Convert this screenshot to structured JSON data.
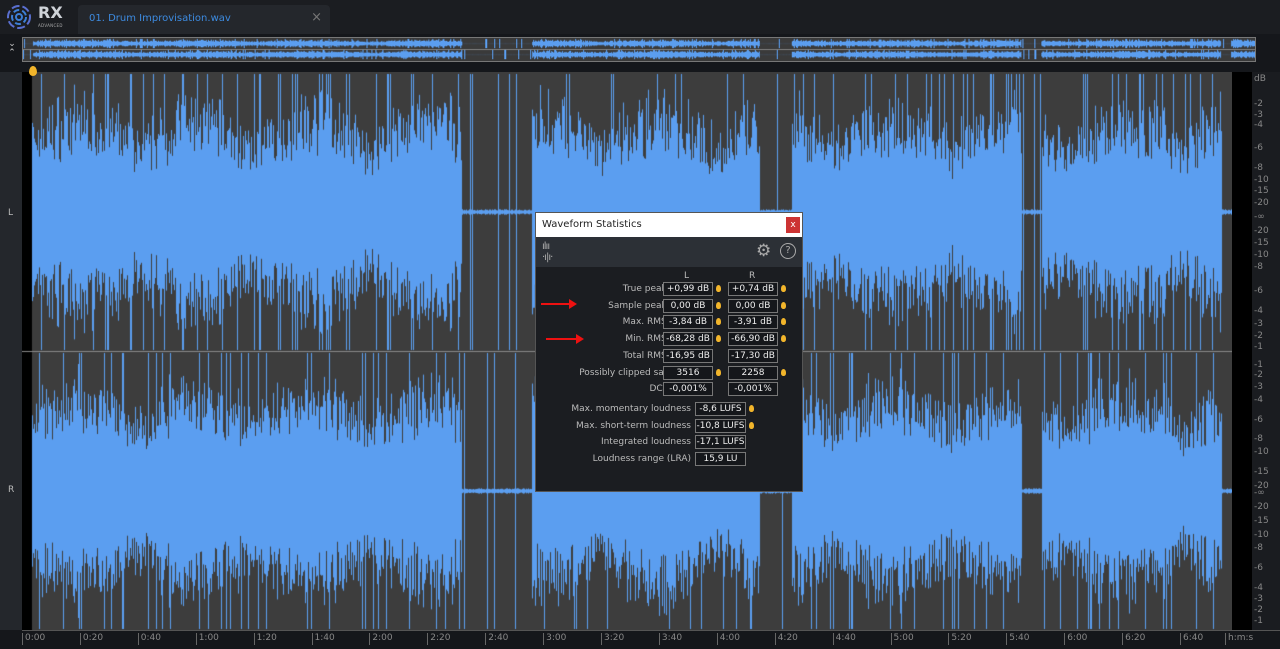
{
  "app": {
    "logo_text": "RX",
    "logo_sub": "ADVANCED"
  },
  "tab": {
    "title": "01. Drum Improvisation.wav",
    "close": "×"
  },
  "channels": {
    "left": "L",
    "right": "R"
  },
  "scale": {
    "unit": "dB",
    "ticks_top": [
      "-2",
      "-3",
      "-4",
      "-6",
      "-8",
      "-10",
      "-15",
      "-20",
      "-∞",
      "-20",
      "-15",
      "-10",
      "-8",
      "-6",
      "-4",
      "-3",
      "-2",
      "-1"
    ],
    "ticks_bottom": [
      "-1",
      "-2",
      "-3",
      "-4",
      "-6",
      "-8",
      "-10",
      "-15",
      "-20",
      "-∞",
      "-20",
      "-15",
      "-10",
      "-8",
      "-6",
      "-4",
      "-3",
      "-2",
      "-1"
    ]
  },
  "timeline": {
    "labels": [
      "0:00",
      "0:20",
      "0:40",
      "1:00",
      "1:20",
      "1:40",
      "2:00",
      "2:20",
      "2:40",
      "3:00",
      "3:20",
      "3:40",
      "4:00",
      "4:20",
      "4:40",
      "5:00",
      "5:20",
      "5:40",
      "6:00",
      "6:20",
      "6:40"
    ],
    "unit": "h:m:s"
  },
  "dialog": {
    "title": "Waveform Statistics",
    "close": "x",
    "col_l": "L",
    "col_r": "R",
    "rows": [
      {
        "label": "True peak level",
        "l": "+0,99 dB",
        "r": "+0,74 dB",
        "bulb_l": true,
        "bulb_r": true
      },
      {
        "label": "Sample peak level",
        "l": "0,00 dB",
        "r": "0,00 dB",
        "bulb_l": true,
        "bulb_r": true
      },
      {
        "label": "Max. RMS level",
        "l": "-3,84 dB",
        "r": "-3,91 dB",
        "bulb_l": true,
        "bulb_r": true
      },
      {
        "label": "Min. RMS level",
        "l": "-68,28 dB",
        "r": "-66,90 dB",
        "bulb_l": true,
        "bulb_r": true
      },
      {
        "label": "Total RMS level",
        "l": "-16,95 dB",
        "r": "-17,30 dB",
        "bulb_l": false,
        "bulb_r": false
      },
      {
        "label": "Possibly clipped samples",
        "l": "3516",
        "r": "2258",
        "bulb_l": true,
        "bulb_r": true
      },
      {
        "label": "DC offset",
        "l": "-0,001%",
        "r": "-0,001%",
        "bulb_l": false,
        "bulb_r": false
      }
    ],
    "loudness": [
      {
        "label": "Max. momentary loudness",
        "v": "-8,6 LUFS",
        "bulb": true
      },
      {
        "label": "Max. short-term loudness",
        "v": "-10,8 LUFS",
        "bulb": true
      },
      {
        "label": "Integrated loudness",
        "v": "-17,1 LUFS",
        "bulb": false
      },
      {
        "label": "Loudness range (LRA)",
        "v": "15,9 LU",
        "bulb": false
      }
    ]
  },
  "colors": {
    "wave": "#5b9ef0",
    "accent": "#3d8be0",
    "bulb": "#f2b52b"
  }
}
